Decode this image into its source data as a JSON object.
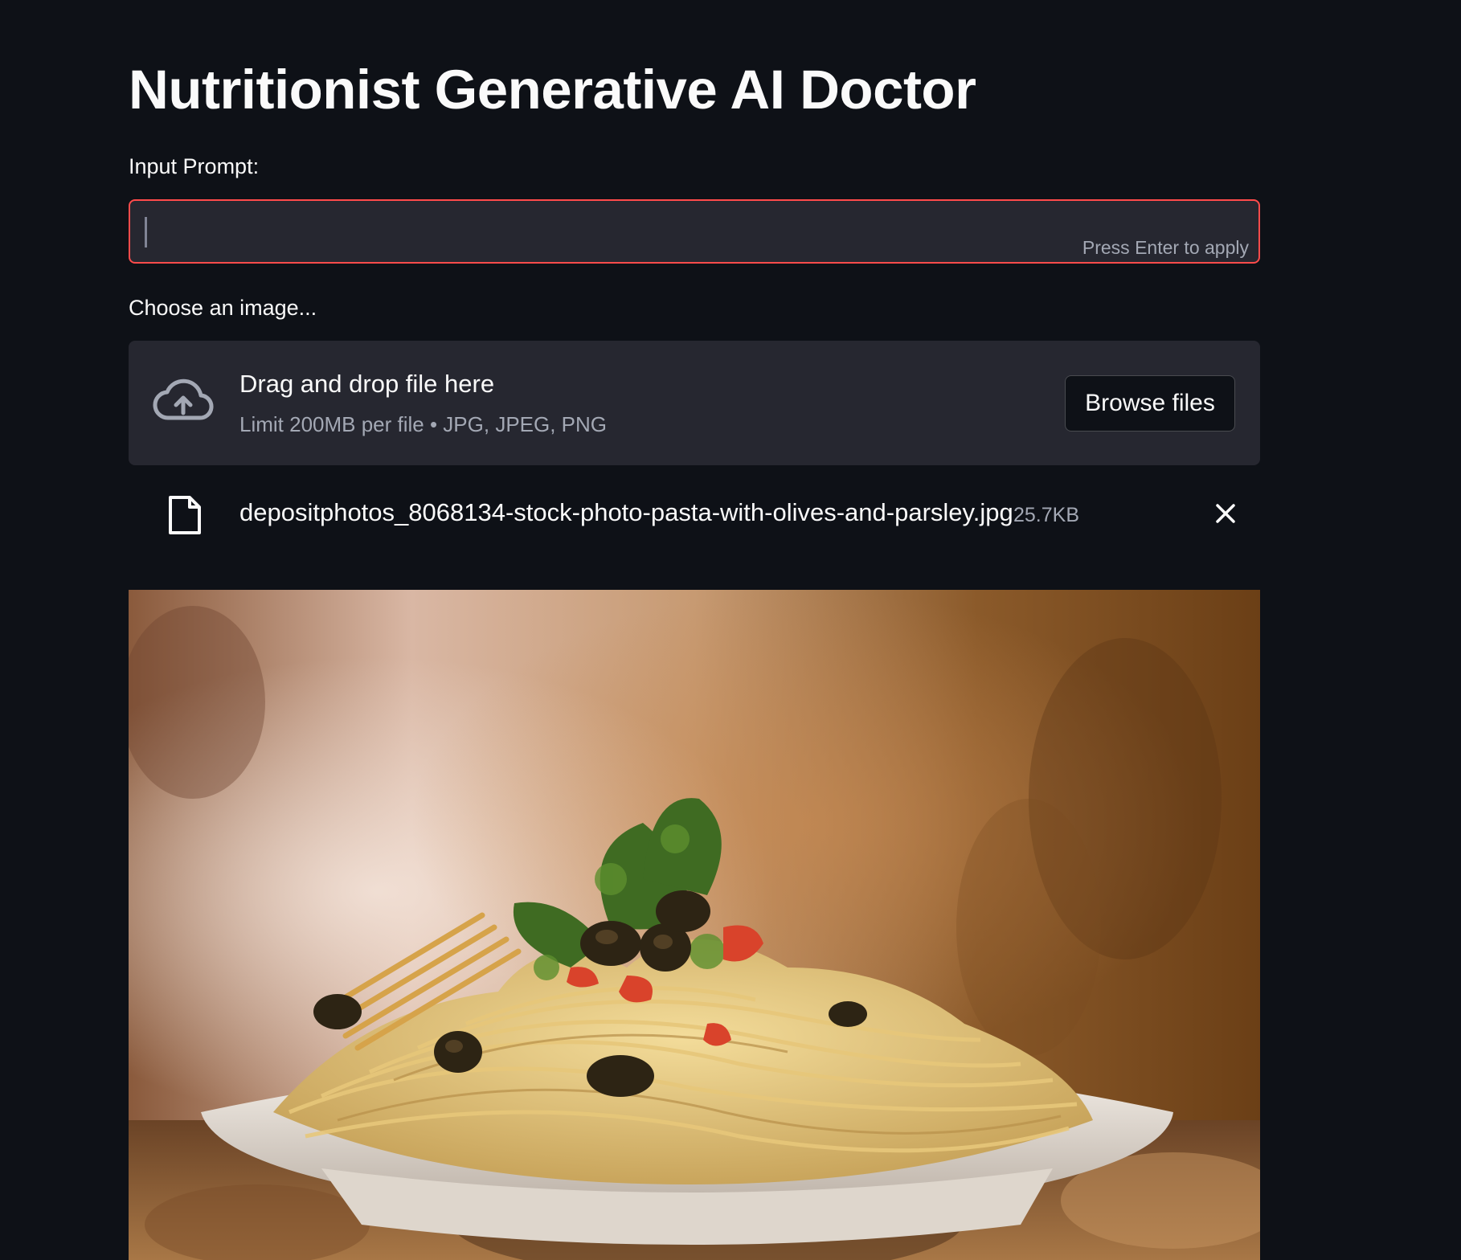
{
  "page": {
    "title": "Nutritionist Generative AI Doctor"
  },
  "prompt": {
    "label": "Input Prompt:",
    "value": "",
    "hint": "Press Enter to apply"
  },
  "uploader": {
    "label": "Choose an image...",
    "dropzone_title": "Drag and drop file here",
    "dropzone_subtitle": "Limit 200MB per file • JPG, JPEG, PNG",
    "browse_label": "Browse files",
    "upload_icon": "cloud-upload-icon"
  },
  "uploaded_file": {
    "name": "depositphotos_8068134-stock-photo-pasta-with-olives-and-parsley.jpg",
    "size": "25.7KB",
    "file_icon": "file-icon",
    "remove_icon": "close-icon"
  },
  "preview": {
    "subject": "Plate of spaghetti with olives, parsley and tomato"
  },
  "colors": {
    "background": "#0e1117",
    "widget_bg": "#262730",
    "focus_border": "#ff4b4b",
    "text": "#fafafa",
    "muted_text": "#a3a8b4"
  }
}
